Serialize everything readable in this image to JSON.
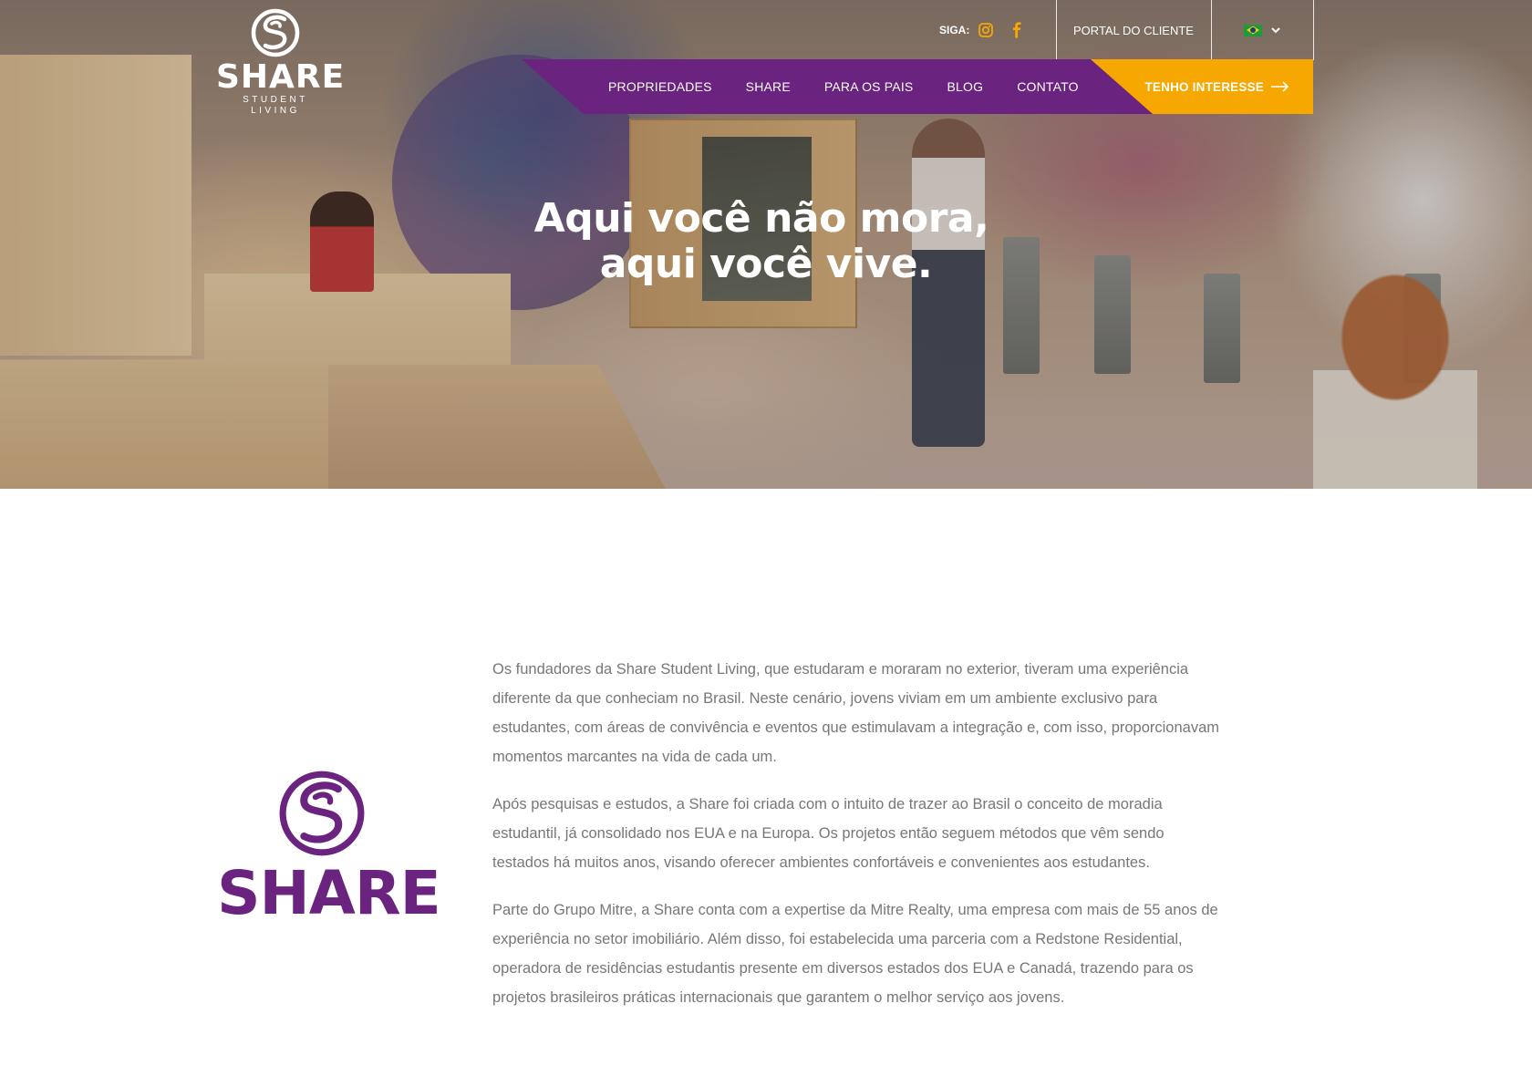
{
  "header": {
    "logo": {
      "brand": "SHARE",
      "tagline": "STUDENT LIVING"
    },
    "follow_label": "SIGA:",
    "social": [
      {
        "name": "instagram-icon",
        "color": "#f7a800"
      },
      {
        "name": "facebook-icon",
        "color": "#f7a800"
      }
    ],
    "portal_label": "PORTAL DO CLIENTE",
    "language": {
      "flag": "brazil-flag-icon",
      "dropdown_icon": "chevron-down-icon"
    },
    "nav": [
      "PROPRIEDADES",
      "SHARE",
      "PARA OS PAIS",
      "BLOG",
      "CONTATO"
    ],
    "cta_label": "TENHO INTERESSE"
  },
  "hero": {
    "title_line1": "Aqui você não mora,",
    "title_line2": "aqui você vive."
  },
  "about": {
    "logo_brand": "SHARE",
    "paragraphs": [
      "Os fundadores da Share Student Living, que estudaram e moraram no exterior, tiveram uma experiência diferente da que conheciam no Brasil. Neste cenário, jovens viviam em um ambiente exclusivo para estudantes, com áreas de convivência e eventos que estimulavam a integração e, com isso, proporcionavam momentos marcantes na vida de cada um.",
      "Após pesquisas e estudos, a Share foi criada com o intuito de trazer ao Brasil o conceito de moradia estudantil, já consolidado nos EUA e na Europa. Os projetos então seguem métodos que vêm sendo testados há muitos anos, visando oferecer ambientes confortáveis e convenientes aos estudantes.",
      "Parte do Grupo Mitre, a Share conta com a expertise da Mitre Realty, uma empresa com mais de 55 anos de experiência no setor imobiliário. Além disso, foi estabelecida uma parceria com a Redstone Residential, operadora de residências estudantis presente em diversos estados dos EUA e Canadá, trazendo para os projetos brasileiros práticas internacionais que garantem o melhor serviço aos jovens."
    ]
  },
  "colors": {
    "purple": "#6b2380",
    "orange": "#f7a800",
    "text_gray": "#777777"
  }
}
